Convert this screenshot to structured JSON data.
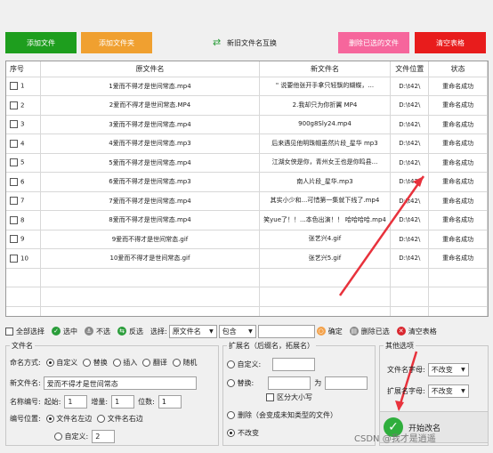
{
  "toolbar": {
    "add_file": "添加文件",
    "add_folder": "添加文件夹",
    "swap": "新旧文件名互换",
    "remove_done": "删除已选的文件",
    "clear_table": "清空表格"
  },
  "table": {
    "headers": [
      "序号",
      "原文件名",
      "新文件名",
      "文件位置",
      "状态"
    ],
    "rows": [
      {
        "idx": "1",
        "orig": "1爱而不得才是世间常态.mp4",
        "new": "\" 说要他张开手拿只轻飘的蝴蝶，...",
        "loc": "D:\\t42\\",
        "status": "重命名成功"
      },
      {
        "idx": "2",
        "orig": "2爱而不得才是世间常态.MP4",
        "new": "2.我却只为你折翼 MP4",
        "loc": "D:\\t42\\",
        "status": "重命名成功"
      },
      {
        "idx": "3",
        "orig": "3爱而不得才是世间常态.mp4",
        "new": "900g8Sly24.mp4",
        "loc": "D:\\t42\\",
        "status": "重命名成功"
      },
      {
        "idx": "4",
        "orig": "4爱而不得才是世间常态.mp3",
        "new": "后来遇见他明珠帽虽然片段_星华 mp3",
        "loc": "D:\\t42\\",
        "status": "重命名成功"
      },
      {
        "idx": "5",
        "orig": "5爱而不得才是世间常态.mp4",
        "new": "江湖女侠是你，青州女王也是你鸣县...",
        "loc": "D:\\t42\\",
        "status": "重命名成功"
      },
      {
        "idx": "6",
        "orig": "6爱而不得才是世间常态.mp3",
        "new": "南人片段_星华.mp3",
        "loc": "D:\\t42\\",
        "status": "重命名成功"
      },
      {
        "idx": "7",
        "orig": "7爱而不得才是世间常态.mp4",
        "new": "其实小少和...可惜第一集就下线了.mp4",
        "loc": "D:\\t42\\",
        "status": "重命名成功"
      },
      {
        "idx": "8",
        "orig": "8爱而不得才是世间常态.mp4",
        "new": "笑yue了！！...本色出演！！ 哈哈哈哈.mp4",
        "loc": "D:\\t42\\",
        "status": "重命名成功"
      },
      {
        "idx": "9",
        "orig": "9爱而不得才是世间常态.gif",
        "new": "张艺兴4.gif",
        "loc": "D:\\t42\\",
        "status": "重命名成功"
      },
      {
        "idx": "10",
        "orig": "10爱而不得才是世间常态.gif",
        "new": "张艺兴5.gif",
        "loc": "D:\\t42\\",
        "status": "重命名成功"
      }
    ]
  },
  "selbar": {
    "select_all": "全部选择",
    "select": "选中",
    "deselect": "不选",
    "invert": "反选",
    "choose_label": "选择:",
    "field_value": "原文件名",
    "mode_value": "包含",
    "confirm": "确定",
    "delete_selected": "删除已选",
    "clear_table": "清空表格"
  },
  "filename": {
    "legend": "文件名",
    "method_label": "命名方式:",
    "opt_custom": "自定义",
    "opt_replace": "替换",
    "opt_insert": "插入",
    "opt_translate": "翻译",
    "opt_random": "随机",
    "new_name_label": "新文件名:",
    "new_name_value": "爱而不得才是世间常态",
    "number_label": "名称编号:",
    "start_label": "起始:",
    "start_value": "1",
    "step_label": "增量:",
    "step_value": "1",
    "digits_label": "位数:",
    "digits_value": "1",
    "pos_label": "编号位置:",
    "pos_left": "文件名左边",
    "pos_right": "文件名右边",
    "pos_custom": "自定义:",
    "pos_custom_value": "2"
  },
  "ext": {
    "legend": "扩展名（后缀名，拓展名）",
    "opt_custom": "自定义:",
    "opt_replace": "替换:",
    "replace_to": "为",
    "case_label": "区分大小写",
    "opt_delete": "删除（会变成未知类型的文件）",
    "opt_keep": "不改变"
  },
  "other": {
    "legend": "其他选项",
    "filename_case_label": "文件名字母:",
    "filename_case_value": "不改变",
    "ext_case_label": "扩展名字母:",
    "ext_case_value": "不改变"
  },
  "start_button": "开始改名",
  "watermark": "CSDN @我才是逍遥"
}
